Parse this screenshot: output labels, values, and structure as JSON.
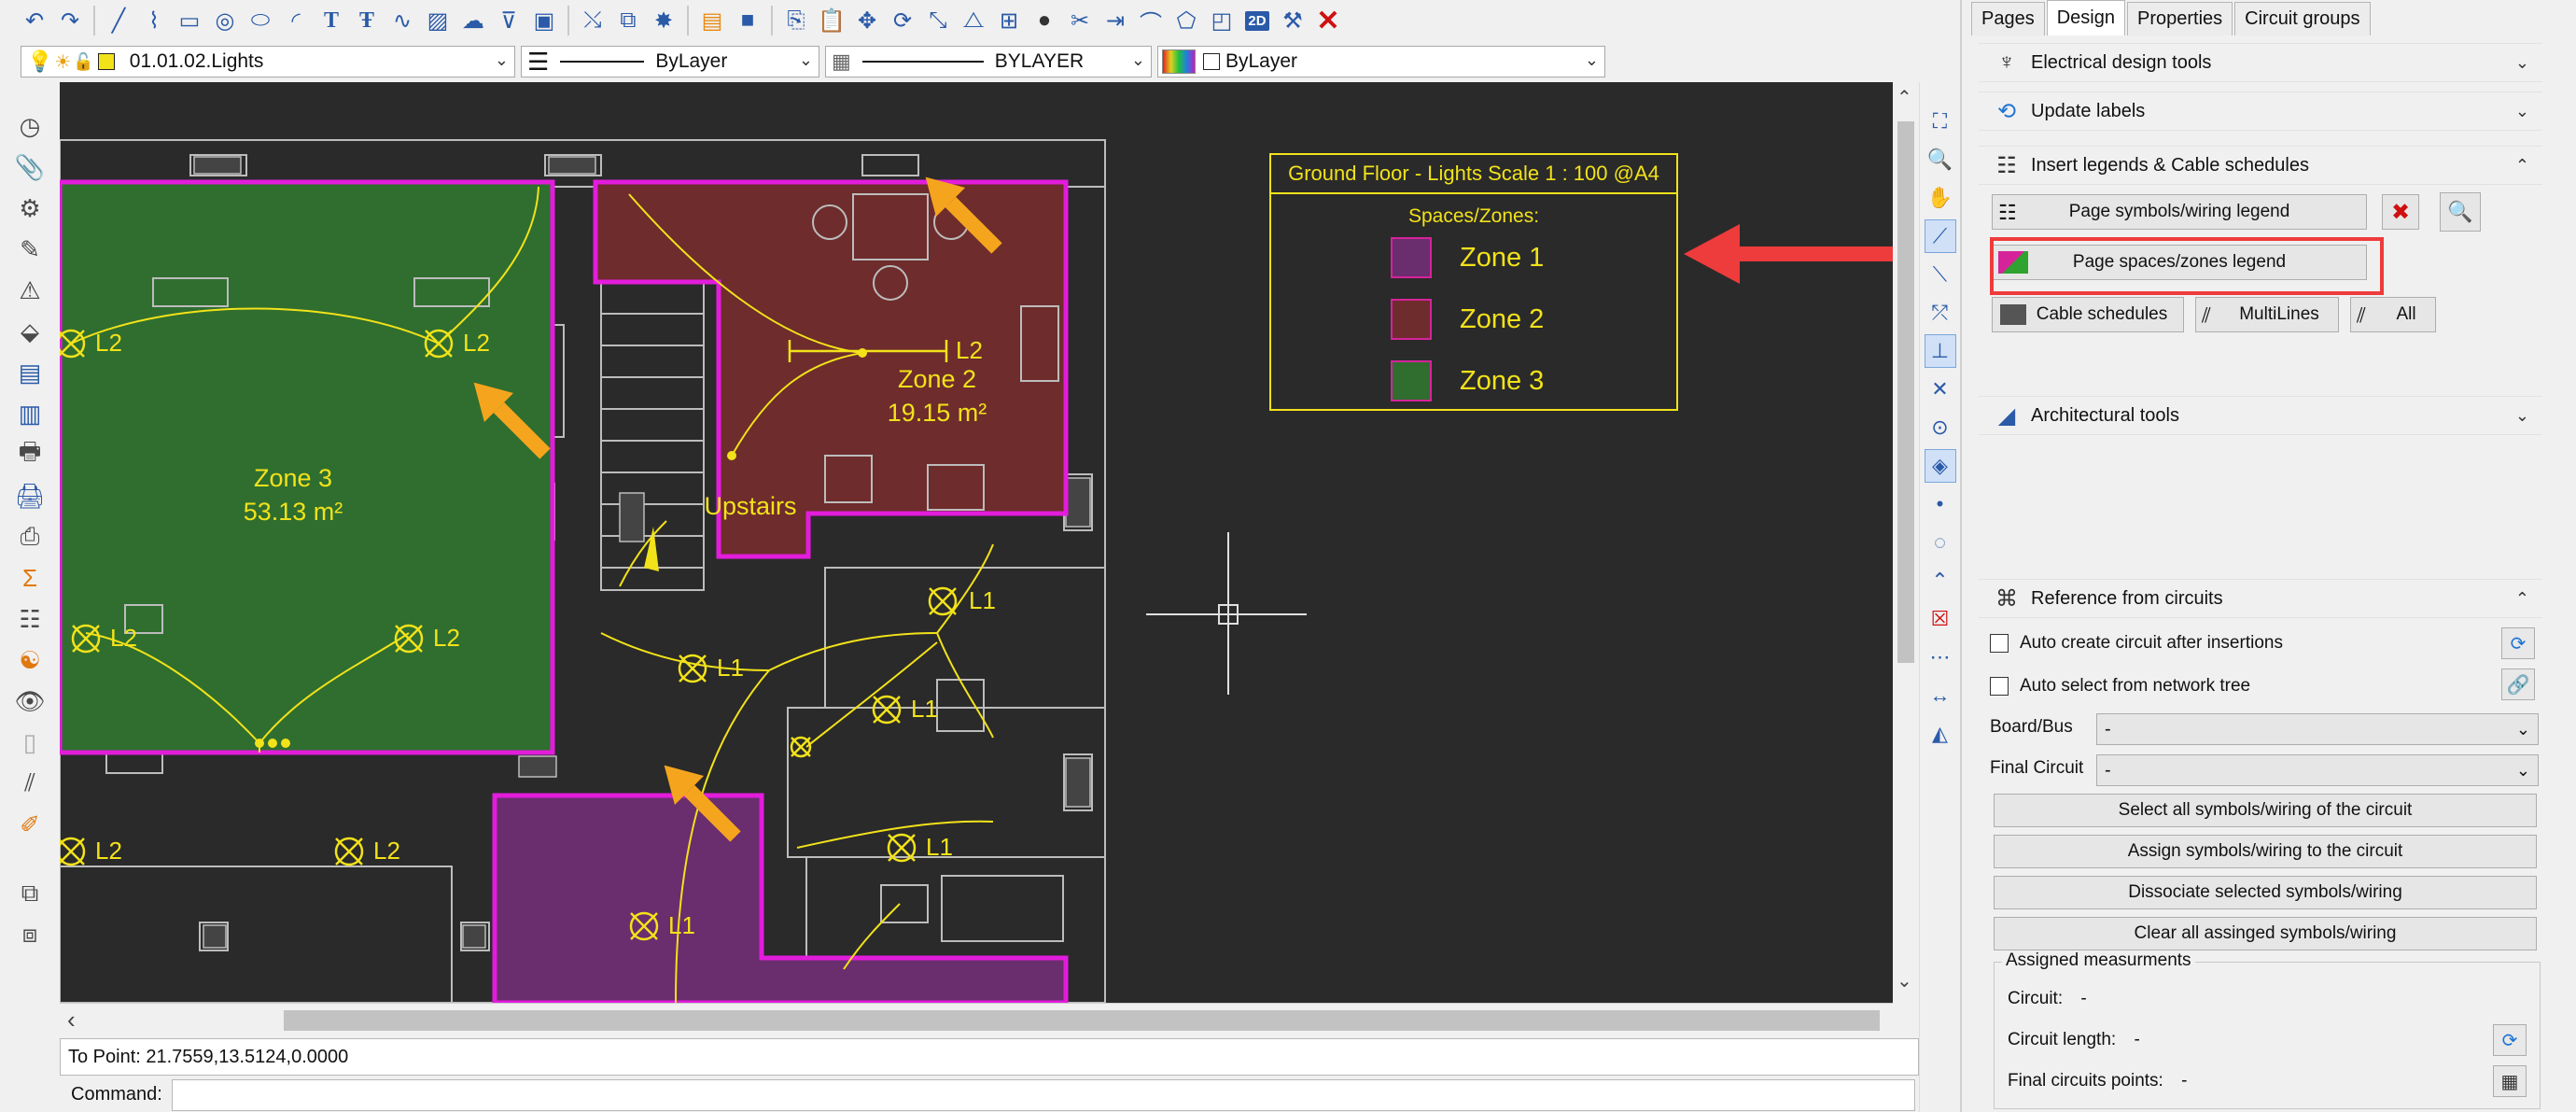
{
  "toolbar": {
    "icons": [
      "undo-icon",
      "redo-icon",
      "line-icon",
      "polyline-icon",
      "rectangle-icon",
      "circle-icon",
      "ellipse-icon",
      "arc-icon",
      "text-icon",
      "mtext-icon",
      "spline-icon",
      "hatch-icon",
      "cloud-icon",
      "leader-icon",
      "image-icon",
      "move-icon",
      "copy-icon",
      "explode-icon",
      "properties-icon",
      "block-icon",
      "copyclip-icon",
      "paste-icon",
      "pan-icon",
      "rotate-icon",
      "scale-icon",
      "mirror-icon",
      "array-icon",
      "sphere-icon",
      "trim-icon",
      "extend-icon",
      "fillet-icon",
      "chamfer-icon",
      "viewport-icon",
      "2d-icon",
      "tools-icon",
      "close-icon"
    ]
  },
  "layer_bar": {
    "layer_name": "01.01.02.Lights",
    "linetype": "ByLayer",
    "lineweight": "BYLAYER",
    "color": "ByLayer"
  },
  "drawing": {
    "zones": [
      {
        "label": "Zone 3",
        "area": "53.13 m²"
      },
      {
        "label": "Zone 2",
        "area": "19.15 m²"
      }
    ],
    "upstairs": "Upstairs",
    "symbols": {
      "l1": "L1",
      "l2": "L2"
    },
    "colors": {
      "zone1": "#6a2d6e",
      "zone2": "#6e2c2c",
      "zone3": "#2f6e2f",
      "border": "#e31cdc",
      "ink": "#f2e21a",
      "arrow": "#f5a51d"
    }
  },
  "legend": {
    "title": "Ground Floor - Lights   Scale 1 : 100 @A4",
    "subtitle": "Spaces/Zones:",
    "items": [
      {
        "name": "Zone 1",
        "color": "#6a2d6e"
      },
      {
        "name": "Zone 2",
        "color": "#6e2c2c"
      },
      {
        "name": "Zone 3",
        "color": "#2f6e2f"
      }
    ]
  },
  "command": {
    "status": "To Point: 21.7559,13.5124,0.0000",
    "label": "Command:",
    "value": ""
  },
  "panel": {
    "tabs": [
      "Pages",
      "Design",
      "Properties",
      "Circuit groups"
    ],
    "active_tab": "Design",
    "sections": {
      "electrical": "Electrical design tools",
      "update": "Update labels",
      "legends": "Insert legends & Cable schedules",
      "arch": "Architectural tools",
      "reference": "Reference from circuits"
    },
    "buttons": {
      "symbols_legend": "Page symbols/wiring legend",
      "zones_legend": "Page spaces/zones legend",
      "cable_schedules": "Cable schedules",
      "multilines": "MultiLines",
      "all": "All"
    },
    "reference": {
      "auto_create": "Auto create circuit after insertions",
      "auto_select": "Auto select from network tree",
      "board_label": "Board/Bus",
      "board_value": "-",
      "final_label": "Final Circuit",
      "final_value": "-",
      "btn_select": "Select all symbols/wiring of the circuit",
      "btn_assign": "Assign symbols/wiring to the circuit",
      "btn_dissociate": "Dissociate selected symbols/wiring",
      "btn_clear": "Clear all assinged symbols/wiring"
    },
    "measurements": {
      "title": "Assigned measurments",
      "circuit_label": "Circuit:",
      "circuit_value": "-",
      "length_label": "Circuit length:",
      "length_value": "-",
      "points_label": "Final circuits points:",
      "points_value": "-"
    }
  }
}
